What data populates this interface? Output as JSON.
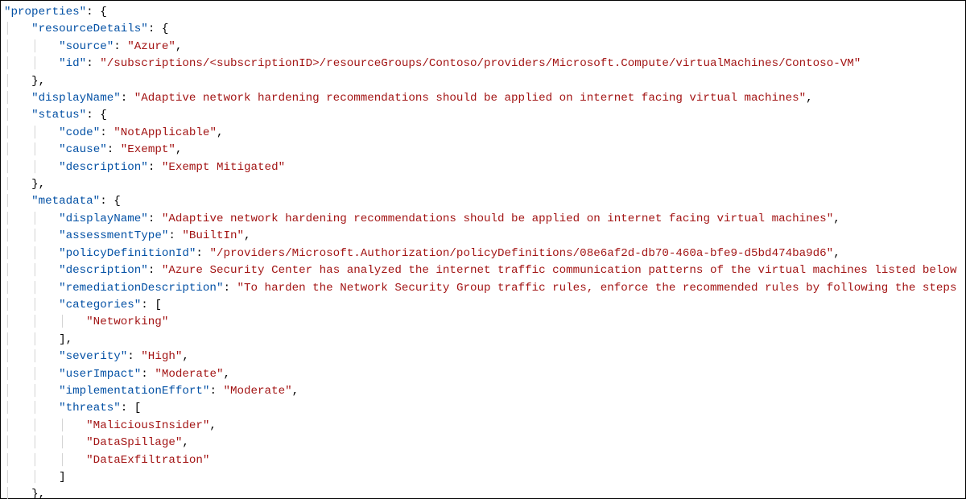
{
  "colors": {
    "key": "#0451a5",
    "string": "#a31515",
    "punctuation": "#000000",
    "guide": "#d4d4d4"
  },
  "lines": [
    {
      "guides": "",
      "tokens": [
        {
          "t": "key",
          "v": "\"properties\""
        },
        {
          "t": "pun",
          "v": ": {"
        }
      ]
    },
    {
      "guides": "│   ",
      "tokens": [
        {
          "t": "key",
          "v": "\"resourceDetails\""
        },
        {
          "t": "pun",
          "v": ": {"
        }
      ]
    },
    {
      "guides": "│   │   ",
      "tokens": [
        {
          "t": "key",
          "v": "\"source\""
        },
        {
          "t": "pun",
          "v": ": "
        },
        {
          "t": "str",
          "v": "\"Azure\""
        },
        {
          "t": "pun",
          "v": ","
        }
      ]
    },
    {
      "guides": "│   │   ",
      "tokens": [
        {
          "t": "key",
          "v": "\"id\""
        },
        {
          "t": "pun",
          "v": ": "
        },
        {
          "t": "str",
          "v": "\"/subscriptions/<subscriptionID>/resourceGroups/Contoso/providers/Microsoft.Compute/virtualMachines/Contoso-VM\""
        }
      ]
    },
    {
      "guides": "│   ",
      "tokens": [
        {
          "t": "pun",
          "v": "},"
        }
      ]
    },
    {
      "guides": "│   ",
      "tokens": [
        {
          "t": "key",
          "v": "\"displayName\""
        },
        {
          "t": "pun",
          "v": ": "
        },
        {
          "t": "str",
          "v": "\"Adaptive network hardening recommendations should be applied on internet facing virtual machines\""
        },
        {
          "t": "pun",
          "v": ","
        }
      ]
    },
    {
      "guides": "│   ",
      "tokens": [
        {
          "t": "key",
          "v": "\"status\""
        },
        {
          "t": "pun",
          "v": ": {"
        }
      ]
    },
    {
      "guides": "│   │   ",
      "tokens": [
        {
          "t": "key",
          "v": "\"code\""
        },
        {
          "t": "pun",
          "v": ": "
        },
        {
          "t": "str",
          "v": "\"NotApplicable\""
        },
        {
          "t": "pun",
          "v": ","
        }
      ]
    },
    {
      "guides": "│   │   ",
      "tokens": [
        {
          "t": "key",
          "v": "\"cause\""
        },
        {
          "t": "pun",
          "v": ": "
        },
        {
          "t": "str",
          "v": "\"Exempt\""
        },
        {
          "t": "pun",
          "v": ","
        }
      ]
    },
    {
      "guides": "│   │   ",
      "tokens": [
        {
          "t": "key",
          "v": "\"description\""
        },
        {
          "t": "pun",
          "v": ": "
        },
        {
          "t": "str",
          "v": "\"Exempt Mitigated\""
        }
      ]
    },
    {
      "guides": "│   ",
      "tokens": [
        {
          "t": "pun",
          "v": "},"
        }
      ]
    },
    {
      "guides": "│   ",
      "tokens": [
        {
          "t": "key",
          "v": "\"metadata\""
        },
        {
          "t": "pun",
          "v": ": {"
        }
      ]
    },
    {
      "guides": "│   │   ",
      "tokens": [
        {
          "t": "key",
          "v": "\"displayName\""
        },
        {
          "t": "pun",
          "v": ": "
        },
        {
          "t": "str",
          "v": "\"Adaptive network hardening recommendations should be applied on internet facing virtual machines\""
        },
        {
          "t": "pun",
          "v": ","
        }
      ]
    },
    {
      "guides": "│   │   ",
      "tokens": [
        {
          "t": "key",
          "v": "\"assessmentType\""
        },
        {
          "t": "pun",
          "v": ": "
        },
        {
          "t": "str",
          "v": "\"BuiltIn\""
        },
        {
          "t": "pun",
          "v": ","
        }
      ]
    },
    {
      "guides": "│   │   ",
      "tokens": [
        {
          "t": "key",
          "v": "\"policyDefinitionId\""
        },
        {
          "t": "pun",
          "v": ": "
        },
        {
          "t": "str",
          "v": "\"/providers/Microsoft.Authorization/policyDefinitions/08e6af2d-db70-460a-bfe9-d5bd474ba9d6\""
        },
        {
          "t": "pun",
          "v": ","
        }
      ]
    },
    {
      "guides": "│   │   ",
      "tokens": [
        {
          "t": "key",
          "v": "\"description\""
        },
        {
          "t": "pun",
          "v": ": "
        },
        {
          "t": "str",
          "v": "\"Azure Security Center has analyzed the internet traffic communication patterns of the virtual machines listed below"
        }
      ]
    },
    {
      "guides": "│   │   ",
      "tokens": [
        {
          "t": "key",
          "v": "\"remediationDescription\""
        },
        {
          "t": "pun",
          "v": ": "
        },
        {
          "t": "str",
          "v": "\"To harden the Network Security Group traffic rules, enforce the recommended rules by following the steps"
        }
      ]
    },
    {
      "guides": "│   │   ",
      "tokens": [
        {
          "t": "key",
          "v": "\"categories\""
        },
        {
          "t": "pun",
          "v": ": ["
        }
      ]
    },
    {
      "guides": "│   │   │   ",
      "tokens": [
        {
          "t": "str",
          "v": "\"Networking\""
        }
      ]
    },
    {
      "guides": "│   │   ",
      "tokens": [
        {
          "t": "pun",
          "v": "],"
        }
      ]
    },
    {
      "guides": "│   │   ",
      "tokens": [
        {
          "t": "key",
          "v": "\"severity\""
        },
        {
          "t": "pun",
          "v": ": "
        },
        {
          "t": "str",
          "v": "\"High\""
        },
        {
          "t": "pun",
          "v": ","
        }
      ]
    },
    {
      "guides": "│   │   ",
      "tokens": [
        {
          "t": "key",
          "v": "\"userImpact\""
        },
        {
          "t": "pun",
          "v": ": "
        },
        {
          "t": "str",
          "v": "\"Moderate\""
        },
        {
          "t": "pun",
          "v": ","
        }
      ]
    },
    {
      "guides": "│   │   ",
      "tokens": [
        {
          "t": "key",
          "v": "\"implementationEffort\""
        },
        {
          "t": "pun",
          "v": ": "
        },
        {
          "t": "str",
          "v": "\"Moderate\""
        },
        {
          "t": "pun",
          "v": ","
        }
      ]
    },
    {
      "guides": "│   │   ",
      "tokens": [
        {
          "t": "key",
          "v": "\"threats\""
        },
        {
          "t": "pun",
          "v": ": ["
        }
      ]
    },
    {
      "guides": "│   │   │   ",
      "tokens": [
        {
          "t": "str",
          "v": "\"MaliciousInsider\""
        },
        {
          "t": "pun",
          "v": ","
        }
      ]
    },
    {
      "guides": "│   │   │   ",
      "tokens": [
        {
          "t": "str",
          "v": "\"DataSpillage\""
        },
        {
          "t": "pun",
          "v": ","
        }
      ]
    },
    {
      "guides": "│   │   │   ",
      "tokens": [
        {
          "t": "str",
          "v": "\"DataExfiltration\""
        }
      ]
    },
    {
      "guides": "│   │   ",
      "tokens": [
        {
          "t": "pun",
          "v": "]"
        }
      ]
    },
    {
      "guides": "│   ",
      "tokens": [
        {
          "t": "pun",
          "v": "},"
        }
      ]
    }
  ]
}
